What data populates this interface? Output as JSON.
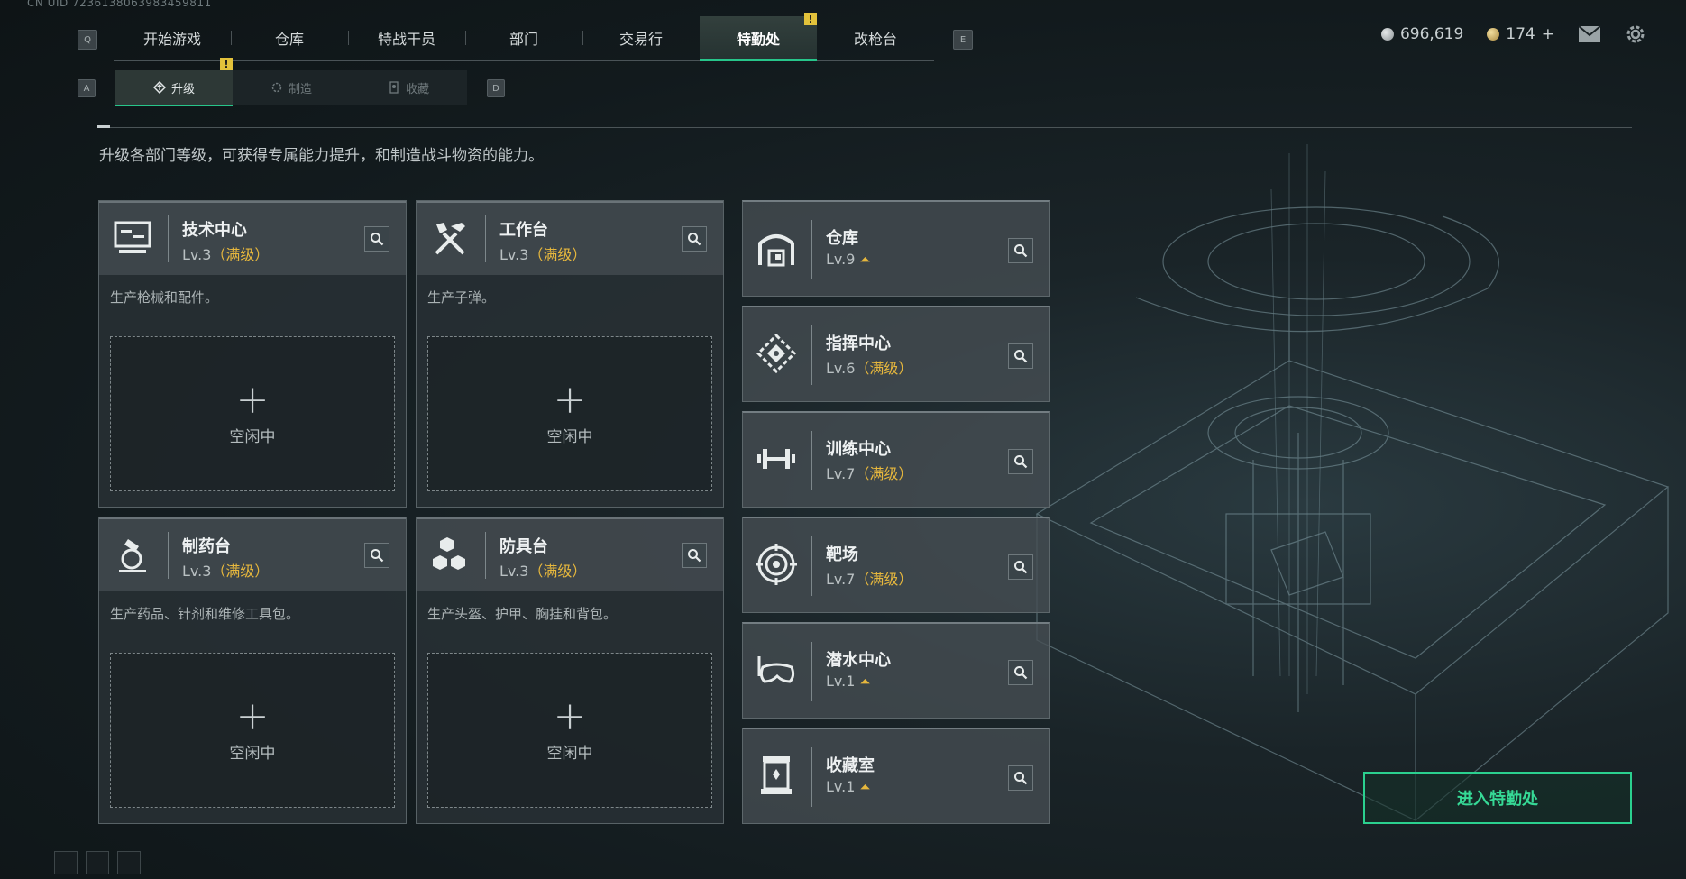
{
  "uid": "CN UID 7236138063983459811",
  "key_hints": {
    "prev_tab": "Q",
    "next_tab": "E",
    "prev_sub": "A",
    "next_sub": "D"
  },
  "main_tabs": [
    {
      "label": "开始游戏",
      "active": false
    },
    {
      "label": "仓库",
      "active": false
    },
    {
      "label": "特战干员",
      "active": false
    },
    {
      "label": "部门",
      "active": false
    },
    {
      "label": "交易行",
      "active": false
    },
    {
      "label": "特勤处",
      "active": true,
      "alert": "!"
    },
    {
      "label": "改枪台",
      "active": false
    }
  ],
  "currency": {
    "silver": "696,619",
    "gold": "174",
    "gold_add": "+"
  },
  "sub_tabs": [
    {
      "label": "升级",
      "active": true,
      "alert": "!",
      "icon": "upgrade-icon"
    },
    {
      "label": "制造",
      "active": false,
      "icon": "craft-icon"
    },
    {
      "label": "收藏",
      "active": false,
      "icon": "collection-icon"
    }
  ],
  "description": "升级各部门等级，可获得专属能力提升，和制造战斗物资的能力。",
  "production_cards": [
    {
      "name": "技术中心",
      "level": "Lv.3",
      "max": "（满级）",
      "desc": "生产枪械和配件。",
      "slot": "空闲中",
      "icon": "computer-icon"
    },
    {
      "name": "工作台",
      "level": "Lv.3",
      "max": "（满级）",
      "desc": "生产子弹。",
      "slot": "空闲中",
      "icon": "tools-icon"
    },
    {
      "name": "制药台",
      "level": "Lv.3",
      "max": "（满级）",
      "desc": "生产药品、针剂和维修工具包。",
      "slot": "空闲中",
      "icon": "microscope-icon"
    },
    {
      "name": "防具台",
      "level": "Lv.3",
      "max": "（满级）",
      "desc": "生产头盔、护甲、胸挂和背包。",
      "slot": "空闲中",
      "icon": "armor-cubes-icon"
    }
  ],
  "department_cards": [
    {
      "name": "仓库",
      "level": "Lv.9",
      "max": "",
      "upgradable": true,
      "icon": "warehouse-icon"
    },
    {
      "name": "指挥中心",
      "level": "Lv.6",
      "max": "（满级）",
      "upgradable": false,
      "icon": "command-icon"
    },
    {
      "name": "训练中心",
      "level": "Lv.7",
      "max": "（满级）",
      "upgradable": false,
      "icon": "dumbbell-icon"
    },
    {
      "name": "靶场",
      "level": "Lv.7",
      "max": "（满级）",
      "upgradable": false,
      "icon": "target-icon"
    },
    {
      "name": "潜水中心",
      "level": "Lv.1",
      "max": "",
      "upgradable": true,
      "icon": "diving-mask-icon"
    },
    {
      "name": "收藏室",
      "level": "Lv.1",
      "max": "",
      "upgradable": true,
      "icon": "display-case-icon"
    }
  ],
  "enter_button": "进入特勤处",
  "colors": {
    "accent_green": "#27c58a",
    "level_max_gold": "#e6b73d",
    "alert_yellow": "#e3c23b"
  }
}
